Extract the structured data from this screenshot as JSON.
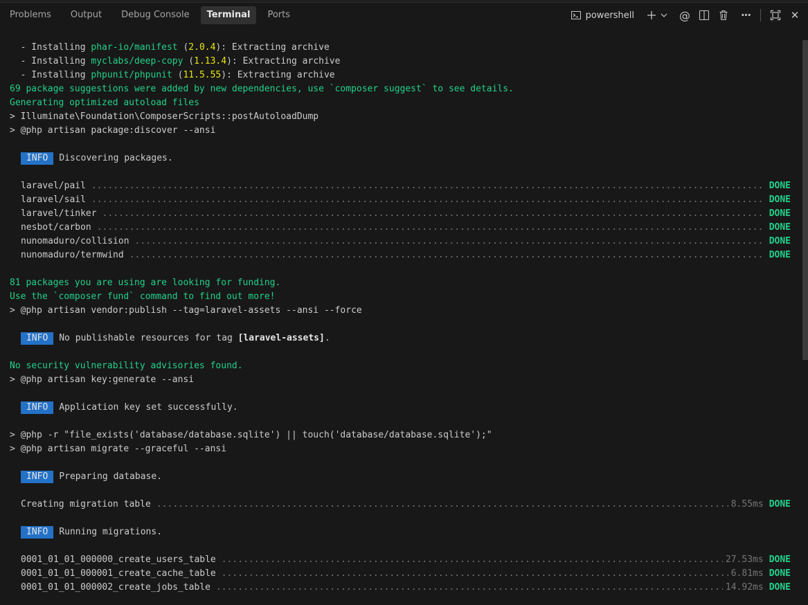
{
  "tabs": [
    {
      "label": "Problems"
    },
    {
      "label": "Output"
    },
    {
      "label": "Debug Console"
    },
    {
      "label": "Terminal",
      "active": true
    },
    {
      "label": "Ports"
    }
  ],
  "toolbar": {
    "shell_label": "powershell",
    "icons": [
      "terminal-icon",
      "plus-icon",
      "chevron-down-icon",
      "at-icon",
      "split-icon",
      "trash-icon",
      "more-icon",
      "maximize-icon",
      "close-icon"
    ],
    "more_glyph": "···",
    "close_glyph": "✕",
    "plus_glyph": "+",
    "at_glyph": "@"
  },
  "colors": {
    "background": "#181818",
    "green": "#23d18b",
    "yellow": "#e5e510",
    "info_badge": "#2472c8",
    "text": "#cccccc",
    "dots": "#767676"
  },
  "terminal": {
    "installs": [
      {
        "prefix": "  - Installing ",
        "pkg": "phar-io/manifest",
        "version": "2.0.4",
        "suffix": ": Extracting archive"
      },
      {
        "prefix": "  - Installing ",
        "pkg": "myclabs/deep-copy",
        "version": "1.13.4",
        "suffix": ": Extracting archive"
      },
      {
        "prefix": "  - Installing ",
        "pkg": "phpunit/phpunit",
        "version": "11.5.55",
        "suffix": ": Extracting archive"
      }
    ],
    "suggestions": "69 package suggestions were added by new dependencies, use `composer suggest` to see details.",
    "autoload": "Generating optimized autoload files",
    "cmd_post_autoload": "> Illuminate\\Foundation\\ComposerScripts::postAutoloadDump",
    "cmd_discover": "> @php artisan package:discover --ansi",
    "info_label": "INFO",
    "info_discovering": "Discovering packages.",
    "packages": [
      {
        "name": "laravel/pail",
        "status": "DONE"
      },
      {
        "name": "laravel/sail",
        "status": "DONE"
      },
      {
        "name": "laravel/tinker",
        "status": "DONE"
      },
      {
        "name": "nesbot/carbon",
        "status": "DONE"
      },
      {
        "name": "nunomaduro/collision",
        "status": "DONE"
      },
      {
        "name": "nunomaduro/termwind",
        "status": "DONE"
      }
    ],
    "funding_1": "81 packages you are using are looking for funding.",
    "funding_2": "Use the `composer fund` command to find out more!",
    "cmd_vendor_publish": "> @php artisan vendor:publish --tag=laravel-assets --ansi --force",
    "info_no_publishable": "No publishable resources for tag ",
    "info_tag": "[laravel-assets]",
    "info_period": ".",
    "no_vulnerabilities": "No security vulnerability advisories found.",
    "cmd_key_generate": "> @php artisan key:generate --ansi",
    "info_key_set": "Application key set successfully.",
    "cmd_touch": "> @php -r \"file_exists('database/database.sqlite') || touch('database/database.sqlite');\"",
    "cmd_migrate": "> @php artisan migrate --graceful --ansi",
    "info_preparing": "Preparing database.",
    "migration_table": {
      "name": "Creating migration table",
      "time": "8.55ms",
      "status": "DONE"
    },
    "info_running": "Running migrations.",
    "migrations": [
      {
        "name": "0001_01_01_000000_create_users_table",
        "time": "27.53ms",
        "status": "DONE"
      },
      {
        "name": "0001_01_01_000001_create_cache_table",
        "time": "6.81ms",
        "status": "DONE"
      },
      {
        "name": "0001_01_01_000002_create_jobs_table",
        "time": "14.92ms",
        "status": "DONE"
      }
    ]
  }
}
